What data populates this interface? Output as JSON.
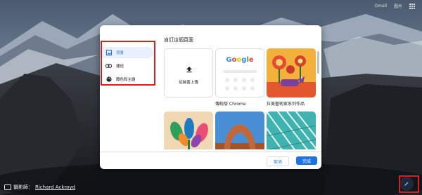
{
  "topbar": {
    "gmail": "Gmail",
    "images": "圖片"
  },
  "credit": {
    "prefix": "攝影師：",
    "author": "Richard Ackroyd"
  },
  "dialog": {
    "title": "自訂這個頁面",
    "sidebar": [
      {
        "label": "背景",
        "icon": "image-icon",
        "active": true
      },
      {
        "label": "捷徑",
        "icon": "link-icon",
        "active": false
      },
      {
        "label": "顏色和主題",
        "icon": "palette-icon",
        "active": false
      }
    ],
    "tiles": {
      "upload_label": "從裝置上傳",
      "google_logo": "Google",
      "classic_label": "傳統版 Chrome",
      "art_label": "拉美藝術家系列作品"
    },
    "buttons": {
      "cancel": "取消",
      "done": "完成"
    }
  },
  "colors": {
    "accent": "#1a73e8",
    "highlight": "#d32020"
  }
}
